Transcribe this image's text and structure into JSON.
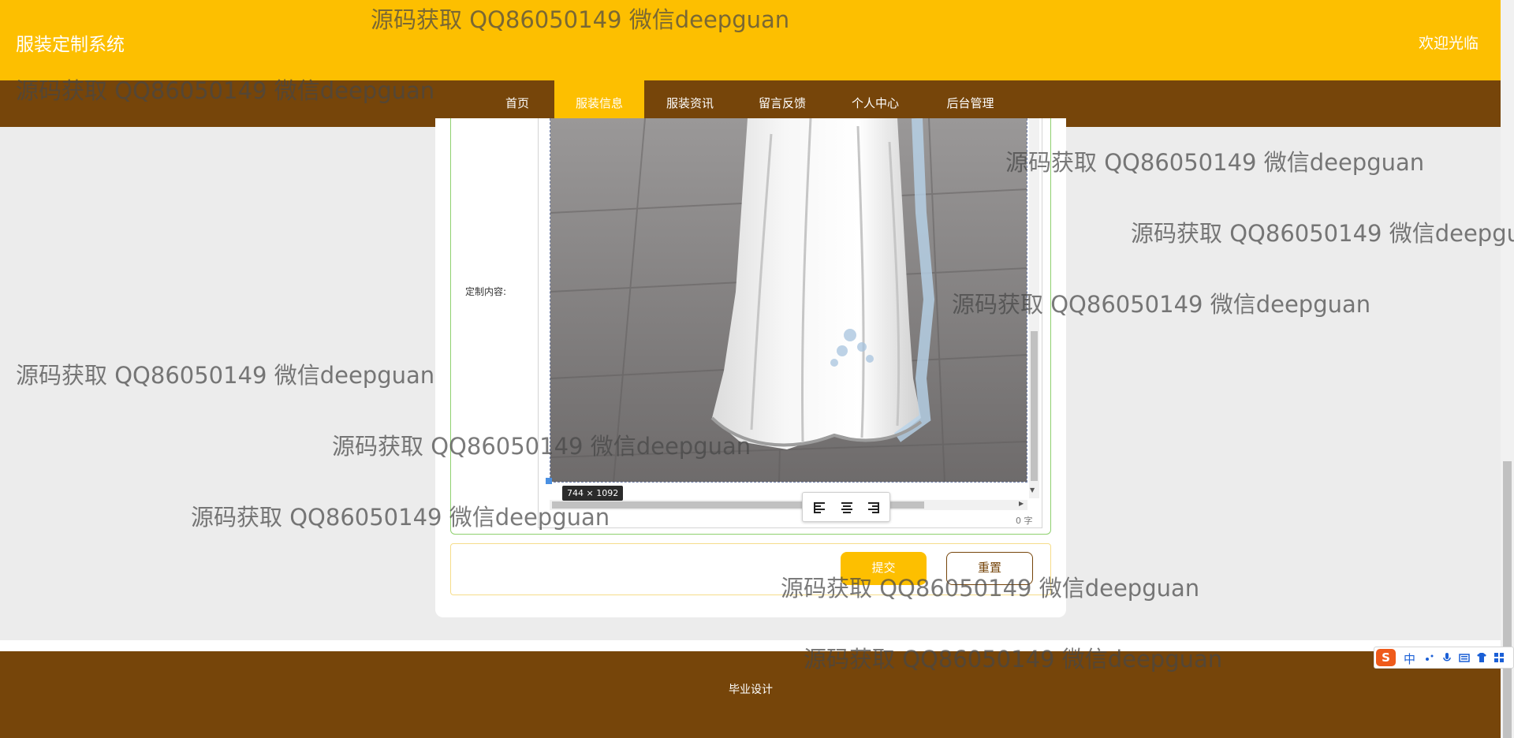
{
  "header": {
    "site_title": "服装定制系统",
    "welcome_text": "欢迎光临"
  },
  "nav": {
    "items": [
      {
        "label": "首页",
        "active": false
      },
      {
        "label": "服装信息",
        "active": true
      },
      {
        "label": "服装资讯",
        "active": false
      },
      {
        "label": "留言反馈",
        "active": false
      },
      {
        "label": "个人中心",
        "active": false
      },
      {
        "label": "后台管理",
        "active": false
      }
    ]
  },
  "form": {
    "content_label": "定制内容:",
    "editor": {
      "image_size_label": "744 × 1092",
      "word_count": "0 字",
      "align_buttons": [
        "align-left-icon",
        "align-center-icon",
        "align-right-icon"
      ]
    },
    "submit_label": "提交",
    "reset_label": "重置"
  },
  "footer": {
    "text": "毕业设计"
  },
  "ime": {
    "mode_label": "中"
  },
  "watermark": {
    "text": "源码获取 QQ86050149 微信deepguan",
    "text_cut": "源码获取 QQ86050149 微信deepgu"
  },
  "colors": {
    "primary_yellow": "#fdbf00",
    "primary_brown": "#76450a",
    "background": "#ececec"
  }
}
